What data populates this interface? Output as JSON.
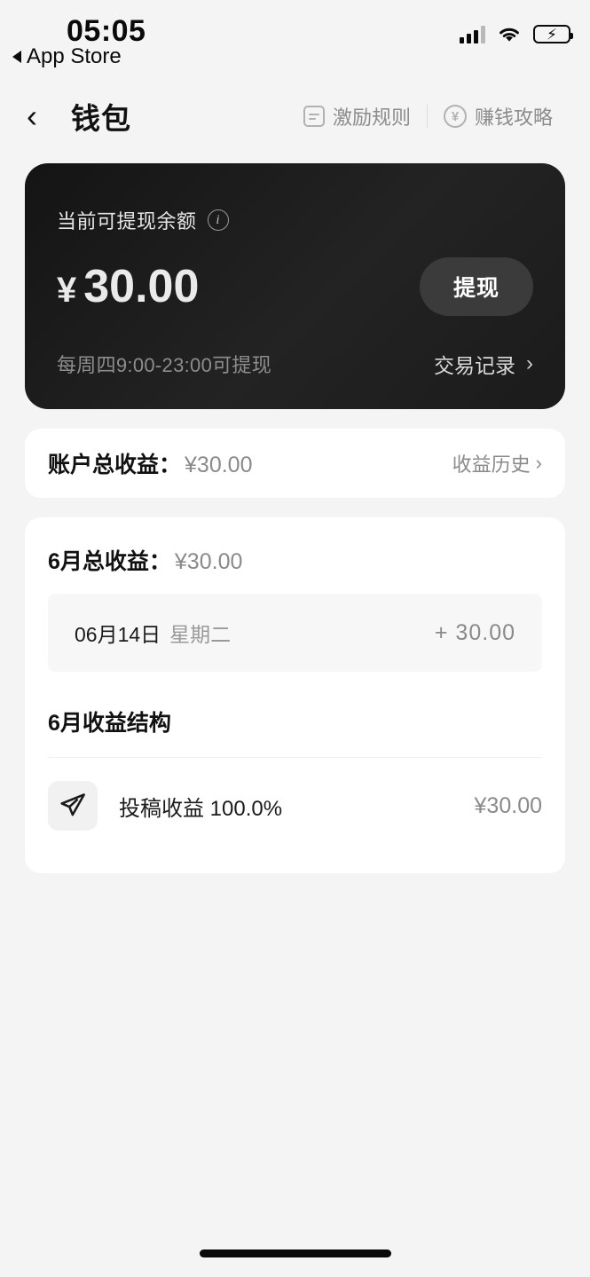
{
  "status_bar": {
    "time": "05:05",
    "return_app_label": "App Store",
    "signal_icon": "cellular-signal-icon",
    "wifi_icon": "wifi-icon",
    "battery_icon": "battery-charging-icon",
    "battery_charging": true,
    "battery_color": "#3ddc63"
  },
  "nav": {
    "back_icon": "‹",
    "title": "钱包",
    "actions": [
      {
        "label": "激励规则",
        "icon": "document-rules-icon"
      },
      {
        "label": "赚钱攻略",
        "icon": "yen-circle-icon"
      }
    ]
  },
  "balance_card": {
    "label": "当前可提现余额",
    "info_icon": "info-icon",
    "currency_symbol": "¥",
    "amount": "30.00",
    "withdraw_button": "提现",
    "note": "每周四9:00-23:00可提现",
    "transactions_link": "交易记录",
    "chevron": "›",
    "background_color": "#1b1b1b",
    "button_color": "#3b3b3b"
  },
  "total_earnings": {
    "label": "账户总收益：",
    "value": "¥30.00",
    "history_link": "收益历史",
    "chevron": "›"
  },
  "month_earnings": {
    "label": "6月总收益：",
    "value": "¥30.00",
    "transactions": [
      {
        "date": "06月14日",
        "weekday": "星期二",
        "amount": "+ 30.00"
      }
    ]
  },
  "month_structure": {
    "title": "6月收益结构",
    "items": [
      {
        "icon": "paper-plane-icon",
        "name": "投稿收益 100.0%",
        "value": "¥30.00",
        "percent": 100.0
      }
    ]
  },
  "home_indicator": "home-indicator"
}
